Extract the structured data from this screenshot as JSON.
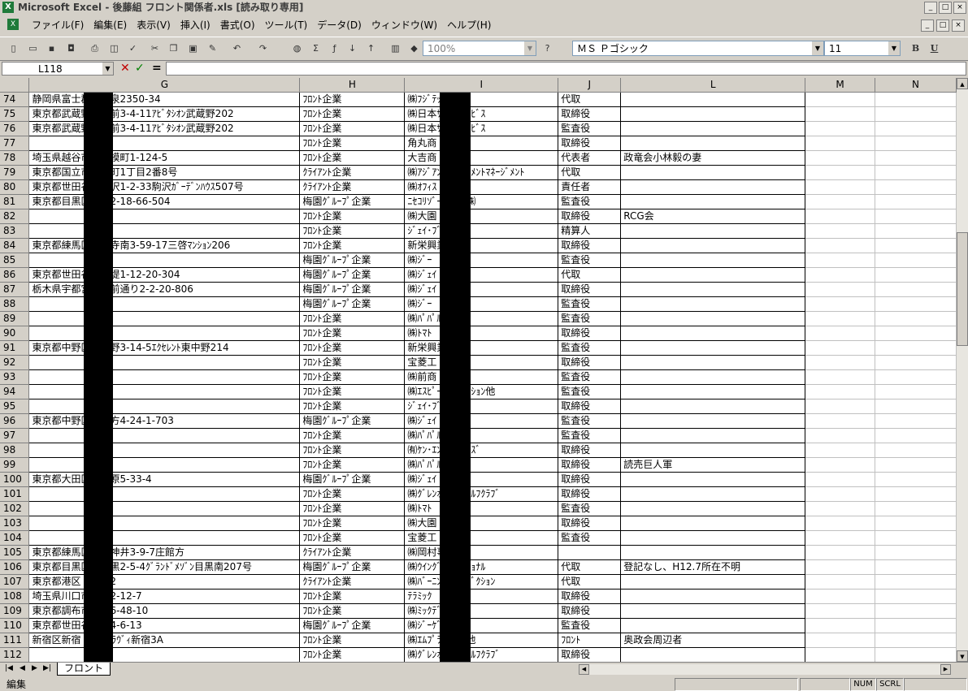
{
  "window": {
    "title": "Microsoft Excel - 後藤組 フロント関係者.xls  [読み取り専用]"
  },
  "menu": [
    "ファイル(F)",
    "編集(E)",
    "表示(V)",
    "挿入(I)",
    "書式(O)",
    "ツール(T)",
    "データ(D)",
    "ウィンドウ(W)",
    "ヘルプ(H)"
  ],
  "toolbar": {
    "zoom": "100%",
    "font": "ＭＳ Ｐゴシック",
    "size": "11",
    "bold": "B",
    "underline": "U"
  },
  "formula": {
    "cell": "L118",
    "cancel": "✕",
    "enter": "✓",
    "equals": "="
  },
  "columns": [
    "G",
    "H",
    "I",
    "J",
    "L",
    "M",
    "N"
  ],
  "rows": [
    {
      "n": "74",
      "g": "静岡県富士郡　小泉2350-34",
      "h": "ﾌﾛﾝﾄ企業",
      "i": "㈱ﾌｼﾞﾃｯｸ",
      "j": "代取",
      "l": ""
    },
    {
      "n": "75",
      "g": "東京都武蔵野市関前3-4-11ｱﾋﾞﾀｼｵﾝ武蔵野202",
      "h": "ﾌﾛﾝﾄ企業",
      "i": "㈱日本ｻｰﾋﾞｽｻｰﾋﾞｽ",
      "j": "取締役",
      "l": ""
    },
    {
      "n": "76",
      "g": "東京都武蔵野市関前3-4-11ｱﾋﾞﾀｼｵﾝ武蔵野202",
      "h": "ﾌﾛﾝﾄ企業",
      "i": "㈱日本ｻｰﾋﾞｽｻｰﾋﾞｽ",
      "j": "監査役",
      "l": ""
    },
    {
      "n": "77",
      "g": "",
      "h": "ﾌﾛﾝﾄ企業",
      "i": "角丸商",
      "j": "取締役",
      "l": ""
    },
    {
      "n": "78",
      "g": "埼玉県越谷市　相模町1-124-5",
      "h": "ﾌﾛﾝﾄ企業",
      "i": "大吉商",
      "j": "代表者",
      "l": "政竜会小林毅の妻"
    },
    {
      "n": "79",
      "g": "東京都国立市西泉町1丁目2番8号",
      "h": "ｸﾗｲｱﾝﾄ企業",
      "i": "㈱ｱｼﾞｱﾝｲﾝﾍﾞｽﾄﾒﾝﾄﾏﾈｰｼﾞﾒﾝﾄ",
      "j": "代取",
      "l": ""
    },
    {
      "n": "80",
      "g": "東京都世田谷区駒沢1-2-33駒沢ｶﾞｰﾃﾞﾝﾊｳｽ507号",
      "h": "ｸﾗｲｱﾝﾄ企業",
      "i": "㈱ｵﾌｨｽ",
      "j": "責任者",
      "l": ""
    },
    {
      "n": "81",
      "g": "東京都目黒区　橋2-18-66-504",
      "h": "梅園ｸﾞﾙｰﾌﾟ企業",
      "i": "ﾆｾｺﾘｿﾞｰﾄ開発㈱",
      "j": "監査役",
      "l": ""
    },
    {
      "n": "82",
      "g": "",
      "h": "ﾌﾛﾝﾄ企業",
      "i": "㈱大園",
      "j": "取締役",
      "l": "RCG会"
    },
    {
      "n": "83",
      "g": "",
      "h": "ﾌﾛﾝﾄ企業",
      "i": "ｼﾞｪｲ･ﾌﾞ",
      "j": "精算人",
      "l": ""
    },
    {
      "n": "84",
      "g": "東京都練馬区　円寺南3-59-17三啓ﾏﾝｼｮﾝ206",
      "h": "ﾌﾛﾝﾄ企業",
      "i": "新栄興業 他",
      "j": "取締役",
      "l": ""
    },
    {
      "n": "85",
      "g": "",
      "h": "梅園ｸﾞﾙｰﾌﾟ企業",
      "i": "㈱ｼﾞｰ",
      "j": "監査役",
      "l": ""
    },
    {
      "n": "86",
      "g": "東京都世田谷区玉堤1-12-20-304",
      "h": "梅園ｸﾞﾙｰﾌﾟ企業",
      "i": "㈱ｼﾞｪｲ",
      "j": "代取",
      "l": ""
    },
    {
      "n": "87",
      "g": "栃木県宇都宮市駅前通り2-2-20-806",
      "h": "梅園ｸﾞﾙｰﾌﾟ企業",
      "i": "㈱ｼﾞｪｲ",
      "j": "取締役",
      "l": ""
    },
    {
      "n": "88",
      "g": "",
      "h": "梅園ｸﾞﾙｰﾌﾟ企業",
      "i": "㈱ｼﾞｰ",
      "j": "監査役",
      "l": ""
    },
    {
      "n": "89",
      "g": "",
      "h": "ﾌﾛﾝﾄ企業",
      "i": "㈱ﾊﾟﾊﾟﾙ",
      "j": "監査役",
      "l": ""
    },
    {
      "n": "90",
      "g": "",
      "h": "ﾌﾛﾝﾄ企業",
      "i": "㈱ﾄﾏﾄ",
      "j": "取締役",
      "l": ""
    },
    {
      "n": "91",
      "g": "東京都中野区東中野3-14-5ｴｸｾﾚﾝﾄ東中野214",
      "h": "ﾌﾛﾝﾄ企業",
      "i": "新栄興業 他",
      "j": "監査役",
      "l": ""
    },
    {
      "n": "92",
      "g": "",
      "h": "ﾌﾛﾝﾄ企業",
      "i": "宝菱工",
      "j": "取締役",
      "l": ""
    },
    {
      "n": "93",
      "g": "",
      "h": "ﾌﾛﾝﾄ企業",
      "i": "㈱前商",
      "j": "監査役",
      "l": ""
    },
    {
      "n": "94",
      "g": "",
      "h": "ﾌﾛﾝﾄ企業",
      "i": "㈱ｴｽﾋﾟｰｺｰﾎﾟﾚｰｼｮﾝ他",
      "j": "監査役",
      "l": ""
    },
    {
      "n": "95",
      "g": "",
      "h": "ﾌﾛﾝﾄ企業",
      "i": "ｼﾞｪｲ･ﾌﾞ",
      "j": "取締役",
      "l": ""
    },
    {
      "n": "96",
      "g": "東京都中野区弥生方4-24-1-703",
      "h": "梅園ｸﾞﾙｰﾌﾟ企業",
      "i": "㈱ｼﾞｪｲ",
      "j": "監査役",
      "l": ""
    },
    {
      "n": "97",
      "g": "",
      "h": "ﾌﾛﾝﾄ企業",
      "i": "㈱ﾊﾟﾊﾟﾙ",
      "j": "監査役",
      "l": ""
    },
    {
      "n": "98",
      "g": "",
      "h": "ﾌﾛﾝﾄ企業",
      "i": "㈲ｹﾝ･ｴﾝﾀｰﾌﾟﾗｲｽﾞ",
      "j": "取締役",
      "l": ""
    },
    {
      "n": "99",
      "g": "",
      "h": "ﾌﾛﾝﾄ企業",
      "i": "㈱ﾊﾟﾊﾟﾙ",
      "j": "取締役",
      "l": "読売巨人軍"
    },
    {
      "n": "100",
      "g": "東京都大田区　が原5-33-4",
      "h": "梅園ｸﾞﾙｰﾌﾟ企業",
      "i": "㈱ｼﾞｪｲ",
      "j": "取締役",
      "l": ""
    },
    {
      "n": "101",
      "g": "",
      "h": "ﾌﾛﾝﾄ企業",
      "i": "㈱ｸﾞﾚﾝｵｰｸﾅｰｺﾞﾙﾌｸﾗﾌﾞ",
      "j": "取締役",
      "l": ""
    },
    {
      "n": "102",
      "g": "",
      "h": "ﾌﾛﾝﾄ企業",
      "i": "㈱ﾄﾏﾄ",
      "j": "監査役",
      "l": ""
    },
    {
      "n": "103",
      "g": "",
      "h": "ﾌﾛﾝﾄ企業",
      "i": "㈱大園",
      "j": "取締役",
      "l": ""
    },
    {
      "n": "104",
      "g": "",
      "h": "ﾌﾛﾝﾄ企業",
      "i": "宝菱工",
      "j": "監査役",
      "l": ""
    },
    {
      "n": "105",
      "g": "東京都練馬区　石神井3-9-7庄館方",
      "h": "ｸﾗｲｱﾝﾄ企業",
      "i": "㈱岡村事務所",
      "j": "",
      "l": ""
    },
    {
      "n": "106",
      "g": "東京都目黒区下目黒2-5-4ｸﾞﾗﾝﾄﾞﾒｿﾞﾝ目黒南207号",
      "h": "梅園ｸﾞﾙｰﾌﾟ企業",
      "i": "㈱ｳｲﾝｸﾞｲﾝﾀｰﾅｼｮﾅﾙ",
      "j": "代取",
      "l": "登記なし、H12.7所在不明"
    },
    {
      "n": "107",
      "g": "東京都港区　4-6-2",
      "h": "ｸﾗｲｱﾝﾄ企業",
      "i": "㈱ﾊﾞｰﾆﾝｸﾞﾌﾟﾛﾀﾞｸｼｮﾝ",
      "j": "代取",
      "l": ""
    },
    {
      "n": "108",
      "g": "埼玉県川口市　塚2-12-7",
      "h": "ﾌﾛﾝﾄ企業",
      "i": "ﾃﾗﾐｯｸ",
      "j": "取締役",
      "l": ""
    },
    {
      "n": "109",
      "g": "東京都調布市　田6-48-10",
      "h": "ﾌﾛﾝﾄ企業",
      "i": "㈱ﾐｯｸﾃﾞｻﾞｲﾝ",
      "j": "取締役",
      "l": ""
    },
    {
      "n": "110",
      "g": "東京都世田谷区砧4-6-13",
      "h": "梅園ｸﾞﾙｰﾌﾟ企業",
      "i": "㈱ｼﾞｰｹﾞ",
      "j": "監査役",
      "l": ""
    },
    {
      "n": "111",
      "g": "新宿区新宿　-17ｾﾗｳﾞｨ新宿3A",
      "h": "ﾌﾛﾝﾄ企業",
      "i": "㈱ｴﾑﾌﾟﾗﾝﾆﾝｸﾞ他",
      "j": "ﾌﾛﾝﾄ",
      "l": "奥政会周辺者"
    },
    {
      "n": "112",
      "g": "",
      "h": "ﾌﾛﾝﾄ企業",
      "i": "㈱ｸﾞﾚﾝｵｰｸﾅｰｺﾞﾙﾌｸﾗﾌﾞ",
      "j": "取締役",
      "l": ""
    }
  ],
  "sheet_tab": "フロント",
  "status": {
    "mode": "編集",
    "num": "NUM",
    "scrl": "SCRL"
  },
  "window_buttons": {
    "min": "_",
    "max": "□",
    "close": "×"
  }
}
